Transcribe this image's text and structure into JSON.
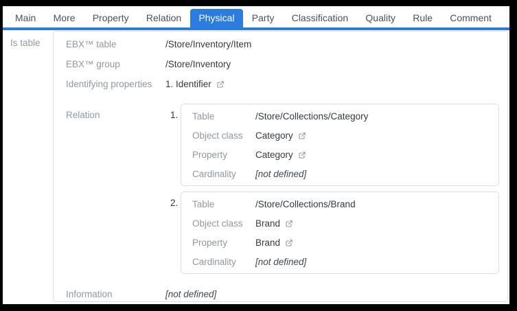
{
  "accent": "#2b7ce0",
  "tabs": [
    {
      "label": "Main"
    },
    {
      "label": "More"
    },
    {
      "label": "Property"
    },
    {
      "label": "Relation"
    },
    {
      "label": "Physical",
      "selected": true
    },
    {
      "label": "Party"
    },
    {
      "label": "Classification"
    },
    {
      "label": "Quality"
    },
    {
      "label": "Rule"
    },
    {
      "label": "Comment"
    }
  ],
  "sidebar": {
    "label": "Is table"
  },
  "panel": {
    "fields": [
      {
        "label": "EBX™ table",
        "value": "/Store/Inventory/Item"
      },
      {
        "label": "EBX™ group",
        "value": "/Store/Inventory"
      },
      {
        "label": "Identifying properties",
        "value": "1. Identifier",
        "icon": "external-link-icon"
      }
    ],
    "relation": {
      "label": "Relation",
      "items": [
        {
          "index": "1.",
          "rows": [
            {
              "label": "Table",
              "value": "/Store/Collections/Category"
            },
            {
              "label": "Object class",
              "value": "Category",
              "icon": "external-link-icon"
            },
            {
              "label": "Property",
              "value": "Category",
              "icon": "external-link-icon"
            },
            {
              "label": "Cardinality",
              "value": "[not defined]",
              "italic": true
            }
          ]
        },
        {
          "index": "2.",
          "rows": [
            {
              "label": "Table",
              "value": "/Store/Collections/Brand"
            },
            {
              "label": "Object class",
              "value": "Brand",
              "icon": "external-link-icon"
            },
            {
              "label": "Property",
              "value": "Brand",
              "icon": "external-link-icon"
            },
            {
              "label": "Cardinality",
              "value": "[not defined]",
              "italic": true
            }
          ]
        }
      ]
    },
    "information": {
      "label": "Information",
      "value": "[not defined]",
      "italic": true
    }
  }
}
